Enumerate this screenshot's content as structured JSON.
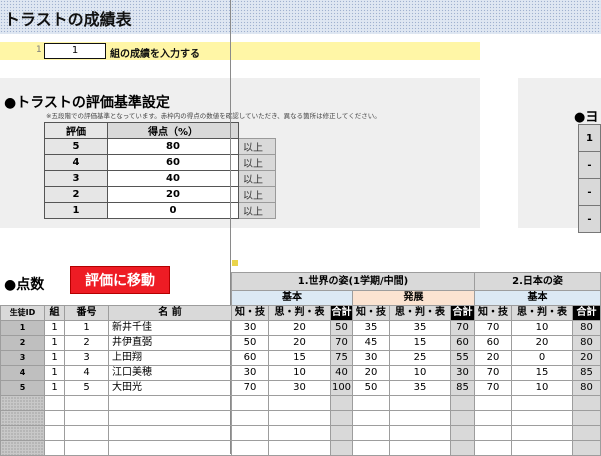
{
  "title": "トラストの成績表",
  "input_row": {
    "row_number": "1",
    "group_value": "1",
    "label": "組の成績を入力する"
  },
  "criteria": {
    "heading": "●トラストの評価基準設定",
    "note": "※五段階での評価基準となっています。赤枠内の得点の数値を確認していただき、異なる箇所は修正してください。",
    "col_grade": "評価",
    "col_score": "得点（%）",
    "rows": [
      {
        "grade": "5",
        "score": "80",
        "unit": "以上"
      },
      {
        "grade": "4",
        "score": "60",
        "unit": "以上"
      },
      {
        "grade": "3",
        "score": "40",
        "unit": "以上"
      },
      {
        "grade": "2",
        "score": "20",
        "unit": "以上"
      },
      {
        "grade": "1",
        "score": "0",
        "unit": "以上"
      }
    ]
  },
  "criteria2": {
    "heading": "●ヨ",
    "cells": [
      "1",
      "-",
      "-",
      "-"
    ]
  },
  "scores": {
    "heading": "●点数",
    "move_button": "評価に移動",
    "unit1": "1.世界の姿(1学期/中間)",
    "unit2": "2.日本の姿",
    "basic": "基本",
    "advanced": "発展",
    "cols": {
      "id": "生徒ID",
      "group": "組",
      "number": "番号",
      "name": "名 前",
      "knowledge": "知・技",
      "thinking": "思・判・表",
      "total": "合計",
      "total2": "合計"
    },
    "students": [
      {
        "id": "1",
        "group": "1",
        "number": "1",
        "name": "新井千佳",
        "a1": "30",
        "a2": "20",
        "at": "50",
        "b1": "35",
        "b2": "35",
        "bt": "70",
        "c1": "70",
        "c2": "10",
        "ct": "80"
      },
      {
        "id": "2",
        "group": "1",
        "number": "2",
        "name": "井伊直弼",
        "a1": "50",
        "a2": "20",
        "at": "70",
        "b1": "45",
        "b2": "15",
        "bt": "60",
        "c1": "60",
        "c2": "20",
        "ct": "80"
      },
      {
        "id": "3",
        "group": "1",
        "number": "3",
        "name": "上田翔",
        "a1": "60",
        "a2": "15",
        "at": "75",
        "b1": "30",
        "b2": "25",
        "bt": "55",
        "c1": "20",
        "c2": "0",
        "ct": "20"
      },
      {
        "id": "4",
        "group": "1",
        "number": "4",
        "name": "江口美穂",
        "a1": "30",
        "a2": "10",
        "at": "40",
        "b1": "20",
        "b2": "10",
        "bt": "30",
        "c1": "70",
        "c2": "15",
        "ct": "85"
      },
      {
        "id": "5",
        "group": "1",
        "number": "5",
        "name": "大田光",
        "a1": "70",
        "a2": "30",
        "at": "100",
        "b1": "50",
        "b2": "35",
        "bt": "85",
        "c1": "70",
        "c2": "10",
        "ct": "80"
      }
    ]
  }
}
